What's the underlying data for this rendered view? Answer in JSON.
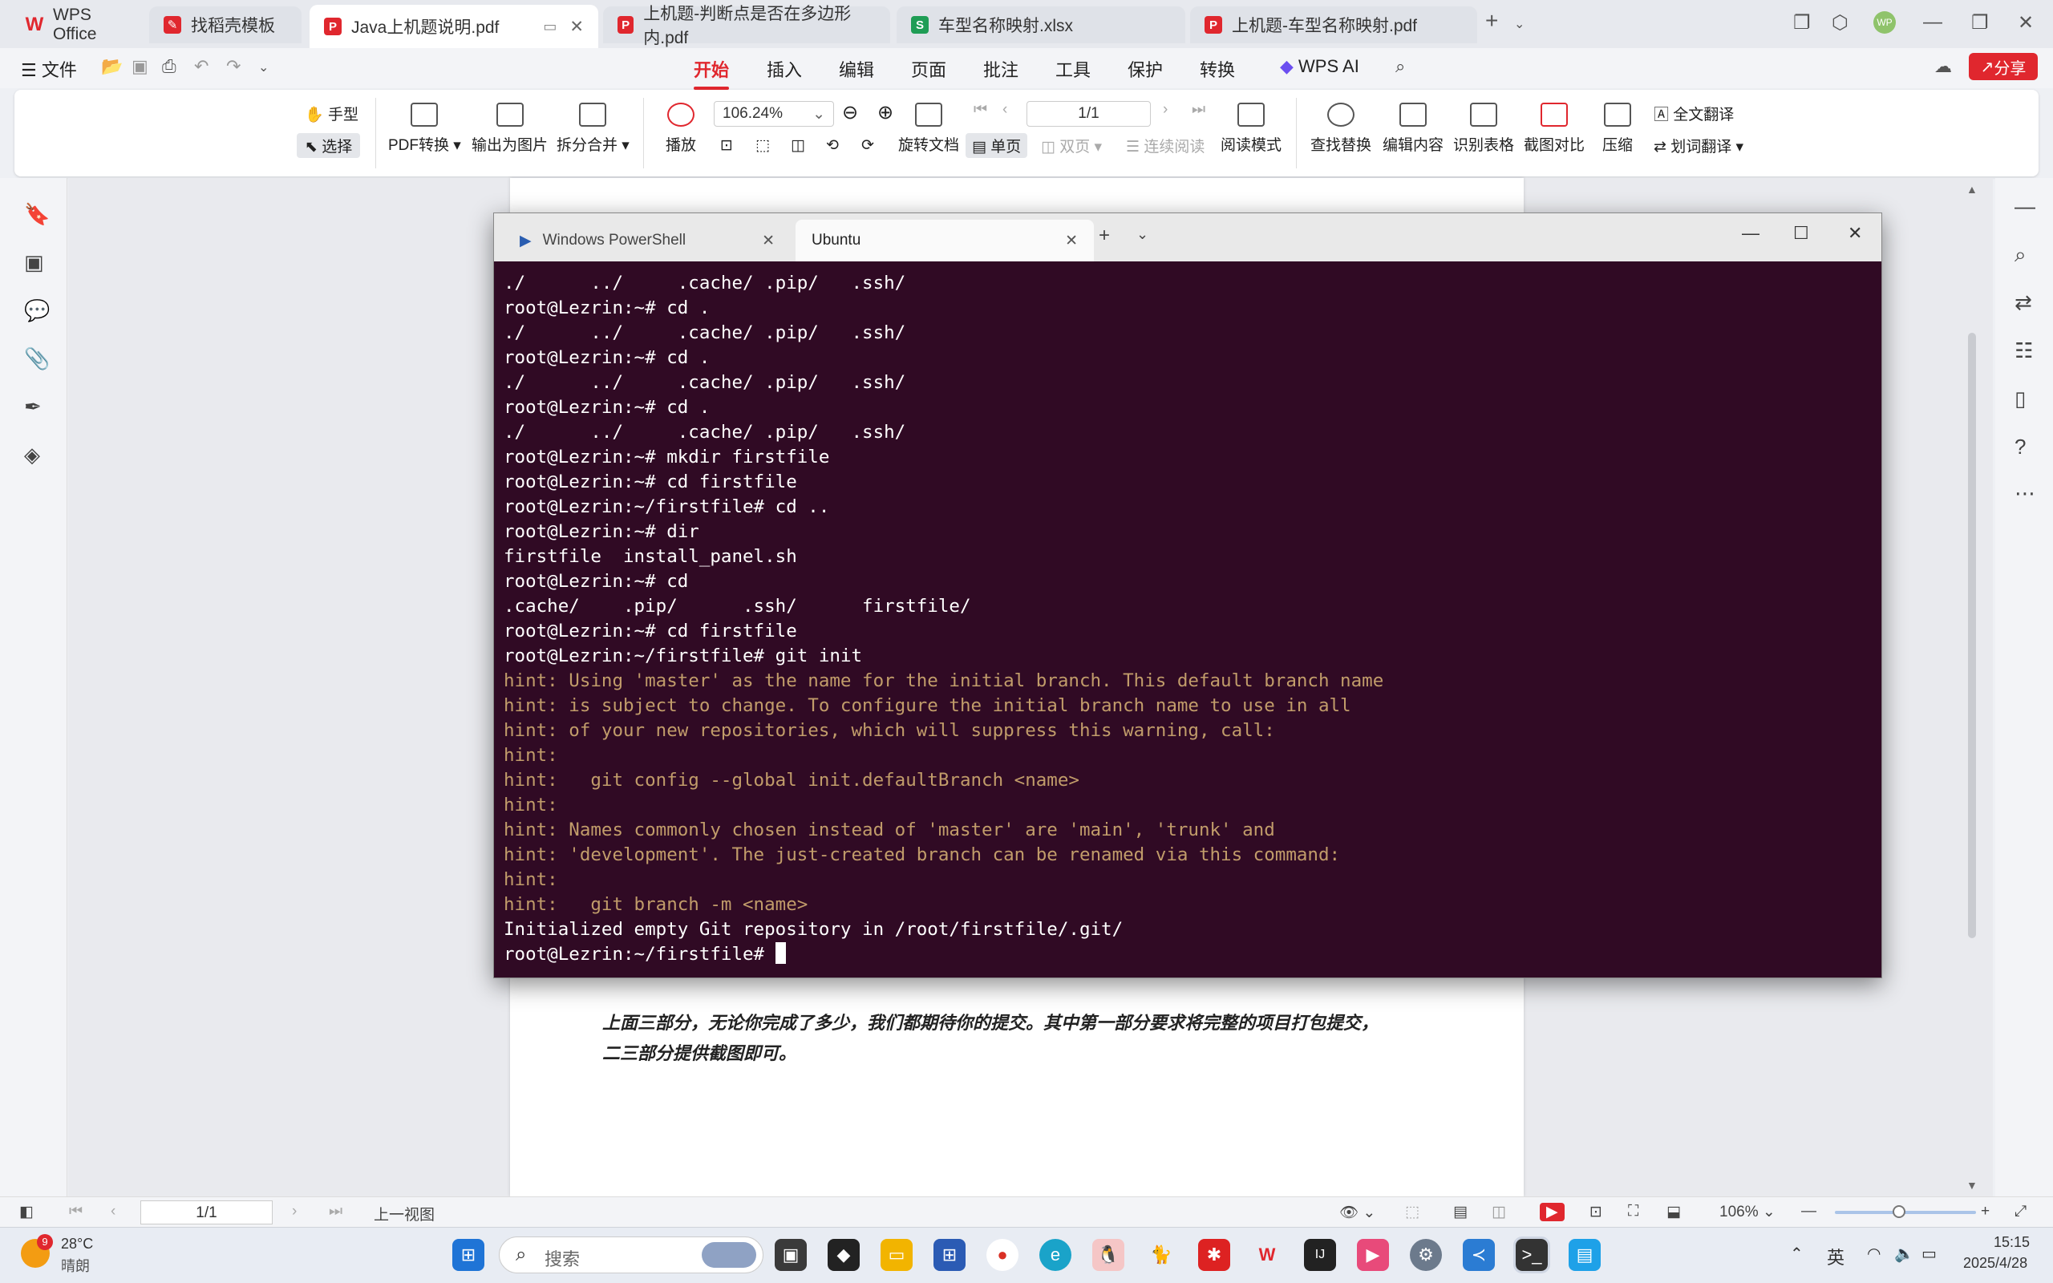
{
  "titlebar": {
    "tabs": [
      {
        "label": "WPS Office",
        "icon": "wps-logo-icon",
        "color": "#e0272e"
      },
      {
        "label": "找稻壳模板",
        "icon": "docer-icon",
        "color": "#e0272e"
      },
      {
        "label": "Java上机题说明.pdf",
        "icon": "pdf-icon",
        "color": "#e0272e"
      },
      {
        "label": "上机题-判断点是否在多边形内.pdf",
        "icon": "pdf-icon",
        "color": "#e0272e"
      },
      {
        "label": "车型名称映射.xlsx",
        "icon": "sheet-icon",
        "color": "#1f9d55"
      },
      {
        "label": "上机题-车型名称映射.pdf",
        "icon": "pdf-icon",
        "color": "#e0272e"
      }
    ],
    "avatar": "WP"
  },
  "menubar": {
    "file": "文件",
    "items": [
      "开始",
      "插入",
      "编辑",
      "页面",
      "批注",
      "工具",
      "保护",
      "转换",
      "WPS AI"
    ],
    "share": "分享"
  },
  "ribbon": {
    "hand": "手型",
    "select": "选择",
    "pdf_convert": "PDF转换",
    "export_image": "输出为图片",
    "split_merge": "拆分合并",
    "play": "播放",
    "zoom": "106.24%",
    "page": "1/1",
    "rotate": "旋转文档",
    "single": "单页",
    "double": "双页",
    "continuous": "连续阅读",
    "read_mode": "阅读模式",
    "find_replace": "查找替换",
    "edit_content": "编辑内容",
    "recognize_table": "识别表格",
    "screenshot_compare": "截图对比",
    "compress": "压缩",
    "full_translate": "全文翻译",
    "word_translate": "划词翻译"
  },
  "document": {
    "text_line1": "上面三部分，无论你完成了多少，我们都期待你的提交。其中第一部分要求将完整的项目打包提交，",
    "text_line2": "二三部分提供截图即可。"
  },
  "terminal": {
    "tabs": [
      "Windows PowerShell",
      "Ubuntu"
    ],
    "lines": [
      {
        "t": "./      ../     .cache/ .pip/   .ssh/",
        "hint": false
      },
      {
        "t": "root@Lezrin:~# cd .",
        "hint": false
      },
      {
        "t": "./      ../     .cache/ .pip/   .ssh/",
        "hint": false
      },
      {
        "t": "root@Lezrin:~# cd .",
        "hint": false
      },
      {
        "t": "./      ../     .cache/ .pip/   .ssh/",
        "hint": false
      },
      {
        "t": "root@Lezrin:~# cd .",
        "hint": false
      },
      {
        "t": "./      ../     .cache/ .pip/   .ssh/",
        "hint": false
      },
      {
        "t": "root@Lezrin:~# mkdir firstfile",
        "hint": false
      },
      {
        "t": "root@Lezrin:~# cd firstfile",
        "hint": false
      },
      {
        "t": "root@Lezrin:~/firstfile# cd ..",
        "hint": false
      },
      {
        "t": "root@Lezrin:~# dir",
        "hint": false
      },
      {
        "t": "firstfile  install_panel.sh",
        "hint": false
      },
      {
        "t": "root@Lezrin:~# cd",
        "hint": false
      },
      {
        "t": ".cache/    .pip/      .ssh/      firstfile/",
        "hint": false
      },
      {
        "t": "root@Lezrin:~# cd firstfile",
        "hint": false
      },
      {
        "t": "root@Lezrin:~/firstfile# git init",
        "hint": false
      },
      {
        "t": "hint: Using 'master' as the name for the initial branch. This default branch name",
        "hint": true
      },
      {
        "t": "hint: is subject to change. To configure the initial branch name to use in all",
        "hint": true
      },
      {
        "t": "hint: of your new repositories, which will suppress this warning, call:",
        "hint": true
      },
      {
        "t": "hint:",
        "hint": true
      },
      {
        "t": "hint:   git config --global init.defaultBranch <name>",
        "hint": true
      },
      {
        "t": "hint:",
        "hint": true
      },
      {
        "t": "hint: Names commonly chosen instead of 'master' are 'main', 'trunk' and",
        "hint": true
      },
      {
        "t": "hint: 'development'. The just-created branch can be renamed via this command:",
        "hint": true
      },
      {
        "t": "hint:",
        "hint": true
      },
      {
        "t": "hint:   git branch -m <name>",
        "hint": true
      },
      {
        "t": "Initialized empty Git repository in /root/firstfile/.git/",
        "hint": false
      }
    ],
    "prompt": "root@Lezrin:~/firstfile# "
  },
  "statusbar": {
    "page": "1/1",
    "prev_view": "上一视图",
    "zoom": "106%"
  },
  "taskbar": {
    "weather_badge": "9",
    "temperature": "28°C",
    "weather": "晴朗",
    "search_placeholder": "搜索",
    "ime": "英",
    "time": "15:15",
    "date": "2025/4/28"
  },
  "colors": {
    "accent": "#e0272e",
    "terminal_bg": "#300a24",
    "hint_text": "#c19c6a"
  }
}
